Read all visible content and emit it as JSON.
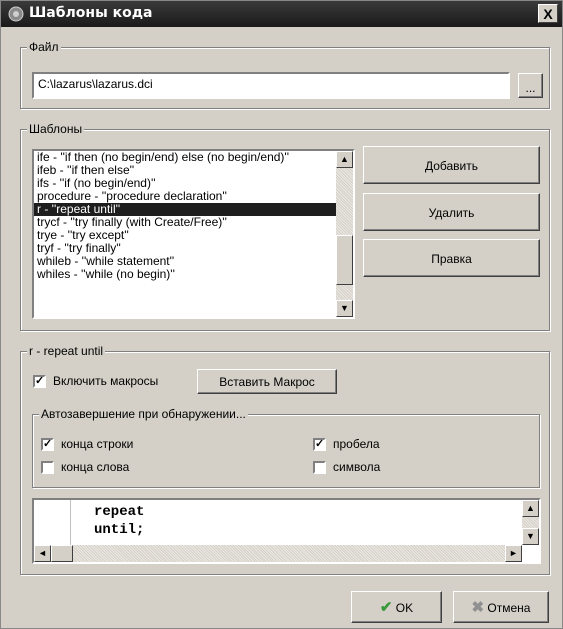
{
  "window": {
    "title": "Шаблоны кода",
    "close_glyph": "X"
  },
  "file_group": {
    "label": "Файл",
    "path_value": "C:\\lazarus\\lazarus.dci",
    "browse_label": "..."
  },
  "templates_group": {
    "label": "Шаблоны",
    "items": [
      "ife - ''if then (no begin/end) else (no begin/end)''",
      "ifeb - ''if then else''",
      "ifs - ''if (no begin/end)''",
      "procedure - ''procedure declaration''",
      "r - ''repeat until''",
      "trycf - ''try finally (with Create/Free)''",
      "trye - ''try except''",
      "tryf - ''try finally''",
      "whileb - ''while statement''",
      "whiles - ''while (no begin)''"
    ],
    "selected_index": 4,
    "add_label": "Добавить",
    "delete_label": "Удалить",
    "edit_label": "Правка"
  },
  "template_group": {
    "label": "r - repeat until",
    "enable_macros_label": "Включить макросы",
    "enable_macros_checked": true,
    "insert_macro_label": "Вставить Макрос",
    "autocomplete": {
      "label": "Автозавершение при обнаружении...",
      "line_end_label": "конца строки",
      "line_end_checked": true,
      "space_label": "пробела",
      "space_checked": true,
      "word_end_label": "конца слова",
      "word_end_checked": false,
      "symbol_label": "символа",
      "symbol_checked": false
    },
    "code_lines": [
      "repeat",
      "until;"
    ]
  },
  "footer": {
    "ok_label": "OK",
    "cancel_label": "Отмена"
  },
  "colors": {
    "dialog_bg": "#d4d0c8",
    "selection_bg": "#1e1e1e",
    "title_bg": "#2a2a2a",
    "ok_check": "#3a9a3a",
    "cancel_x": "#909090"
  }
}
